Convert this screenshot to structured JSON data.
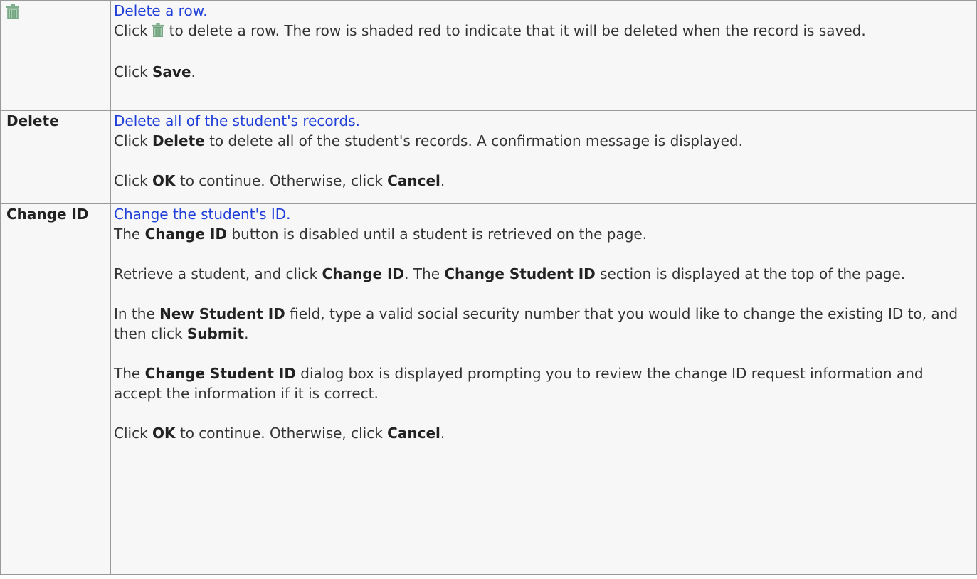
{
  "rows": [
    {
      "term_icon": "trash-can-icon",
      "link": "Delete a row.",
      "p1_before": "Click",
      "p1_icon": "trash-can-icon",
      "p1_after": "to delete a row. The row is shaded red to indicate that it will be deleted when the record is saved.",
      "p2_before": "Click ",
      "p2_bold": "Save",
      "p2_after": "."
    },
    {
      "term": "Delete",
      "link": "Delete all of the student's records.",
      "p1_before": "Click ",
      "p1_bold": "Delete",
      "p1_after": " to delete all of the student's records. A confirmation message is displayed.",
      "p2_before": "Click ",
      "p2_bold1": "OK",
      "p2_mid": " to continue. Otherwise, click ",
      "p2_bold2": "Cancel",
      "p2_after": "."
    },
    {
      "term": "Change ID",
      "link": "Change the student's ID.",
      "p1_before": "The ",
      "p1_bold": "Change ID",
      "p1_after": " button is disabled until a student is retrieved on the page.",
      "p2_before": "Retrieve a student, and click ",
      "p2_bold1": "Change ID",
      "p2_mid": ". The ",
      "p2_bold2": "Change Student ID",
      "p2_after": " section is displayed at the top of the page.",
      "p3_before": "In the ",
      "p3_bold1": "New Student ID",
      "p3_mid": " field, type a valid social security number that you would like to change the existing ID to, and then click ",
      "p3_bold2": "Submit",
      "p3_after": ".",
      "p4_before": "The ",
      "p4_bold": "Change Student ID",
      "p4_after": " dialog box is displayed prompting you to review the change ID request information and accept the information if it is correct.",
      "p5_before": "Click ",
      "p5_bold1": "OK",
      "p5_mid": " to continue. Otherwise, click ",
      "p5_bold2": "Cancel",
      "p5_after": "."
    }
  ],
  "colors": {
    "link": "#1f3fd8",
    "background": "#f7f7f7",
    "border": "#9a9a9a",
    "trash_icon": "#7fae8c"
  }
}
